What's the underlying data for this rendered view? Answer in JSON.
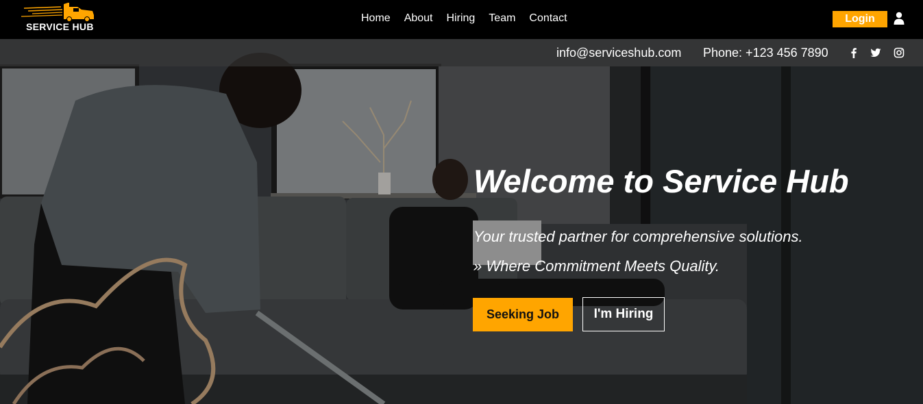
{
  "brand": {
    "name": "SERVICE HUB",
    "accent": "#ffa500"
  },
  "nav": {
    "links": [
      "Home",
      "About",
      "Hiring",
      "Team",
      "Contact"
    ],
    "login_label": "Login",
    "user_icon": "user-icon"
  },
  "info_bar": {
    "email": "info@serviceshub.com",
    "phone": "Phone: +123 456 7890",
    "social_icons": [
      "facebook-icon",
      "twitter-icon",
      "instagram-icon"
    ]
  },
  "hero": {
    "title": "Welcome to Service Hub",
    "subtitle": "Your trusted partner for comprehensive solutions.",
    "tagline": "» Where Commitment Meets Quality.",
    "primary_button": "Seeking Job",
    "secondary_button": "I'm Hiring"
  }
}
